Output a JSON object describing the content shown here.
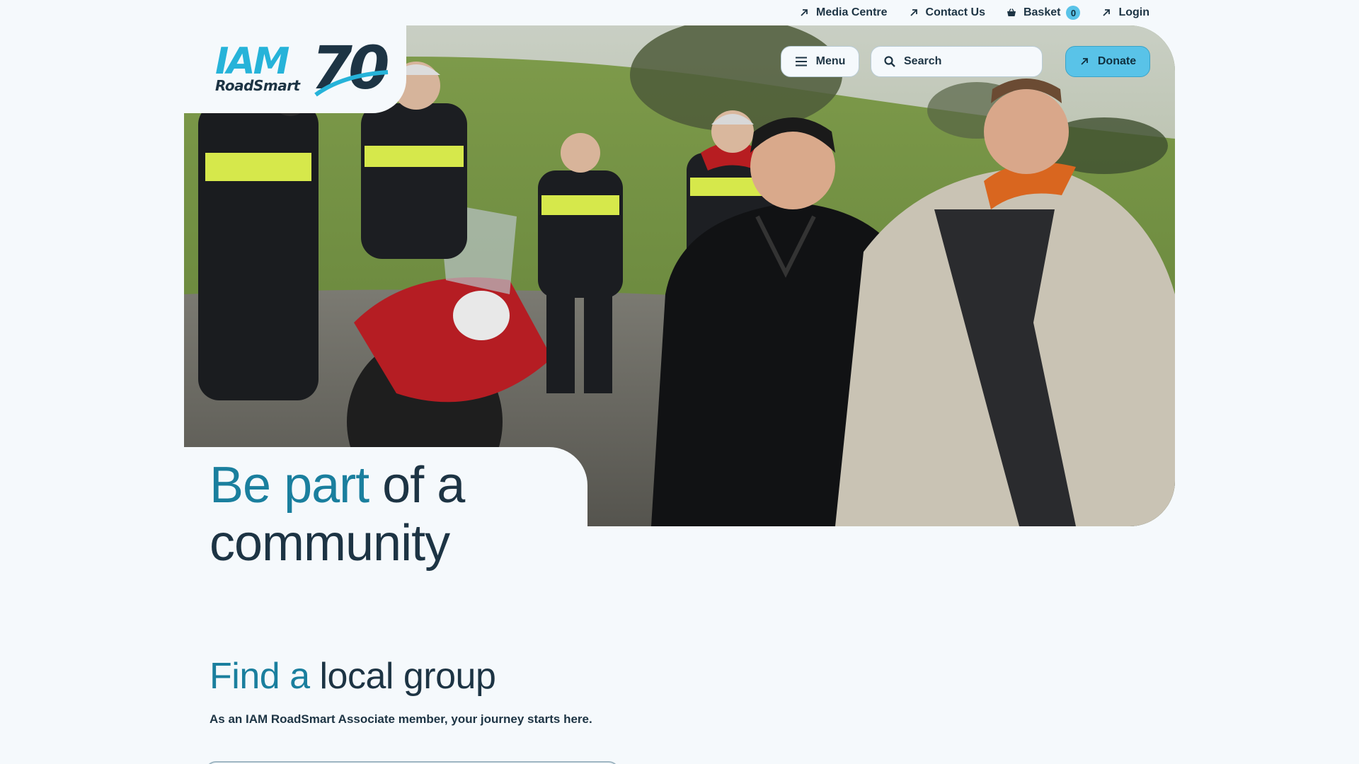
{
  "utility_nav": {
    "media_centre": "Media Centre",
    "contact_us": "Contact Us",
    "basket": "Basket",
    "basket_count": "0",
    "login": "Login"
  },
  "logo": {
    "brand": "IAM",
    "sub": "RoadSmart",
    "anniversary": "70"
  },
  "header": {
    "menu_label": "Menu",
    "search_placeholder": "Search",
    "donate_label": "Donate"
  },
  "hero": {
    "heading_accent": "Be part",
    "heading_rest": " of a community",
    "image_description": "Group of motorcyclists in hi-vis vests chatting beside motorbikes in a grassy countryside setting"
  },
  "find_group": {
    "heading_accent": "Find a",
    "heading_rest": " local group",
    "subtitle": "As an IAM RoadSmart Associate member, your journey starts here."
  },
  "colors": {
    "background": "#f5f9fc",
    "text": "#1d3444",
    "accent_teal": "#1a7f9e",
    "accent_light_blue": "#59c3e8"
  },
  "icons": {
    "external": "arrow-up-right-icon",
    "basket": "basket-icon",
    "menu": "hamburger-icon",
    "search": "search-icon"
  }
}
